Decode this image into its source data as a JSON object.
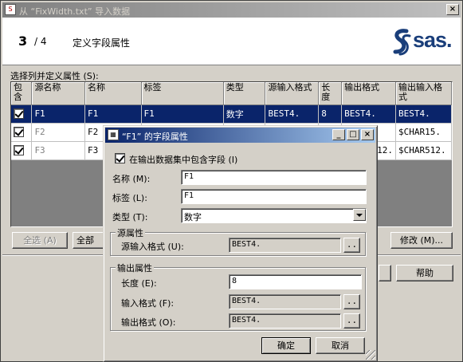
{
  "window": {
    "title": "从 “FixWidth.txt” 导入数据",
    "min_label": "_",
    "max_label": "□",
    "close_label": "×"
  },
  "wizard": {
    "step": "3",
    "total": "/ 4",
    "title": "定义字段属性",
    "logo_text": "sas."
  },
  "grid": {
    "label": "选择列并定义属性 (S):",
    "columns": [
      "包含",
      "源名称",
      "名称",
      "标签",
      "类型",
      "源输入格式",
      "长度",
      "输出格式",
      "输出输入格式"
    ],
    "rows": [
      {
        "source": "F1",
        "name": "F1",
        "label": "F1",
        "type": "数字",
        "src_fmt": "BEST4.",
        "length": "8",
        "out_fmt": "BEST4.",
        "in_fmt": "BEST4."
      },
      {
        "source": "F2",
        "name": "F2",
        "label": "",
        "type": "",
        "src_fmt": "",
        "length": "",
        "out_fmt": "",
        "in_fmt": "$CHAR15."
      },
      {
        "source": "F3",
        "name": "F3",
        "label": "",
        "type": "",
        "src_fmt": "",
        "length": "",
        "out_fmt": "12.",
        "in_fmt": "$CHAR512."
      }
    ]
  },
  "buttons": {
    "select_all": "全选 (A)",
    "all": "全部",
    "modify": "修改 (M)...",
    "help": "帮助"
  },
  "dialog": {
    "title": "“F1” 的字段属性",
    "include_label": "在输出数据集中包含字段 (I)",
    "name_label": "名称 (M):",
    "name_value": "F1",
    "tag_label": "标签 (L):",
    "tag_value": "F1",
    "type_label": "类型 (T):",
    "type_value": "数字",
    "source_group": "源属性",
    "src_format_label": "源输入格式 (U):",
    "src_format_value": "BEST4.",
    "output_group": "输出属性",
    "length_label": "长度 (E):",
    "length_value": "8",
    "input_format_label": "输入格式 (F):",
    "input_format_value": "BEST4.",
    "output_format_label": "输出格式 (O):",
    "output_format_value": "BEST4.",
    "browse_label": "..",
    "ok": "确定",
    "cancel": "取消"
  }
}
